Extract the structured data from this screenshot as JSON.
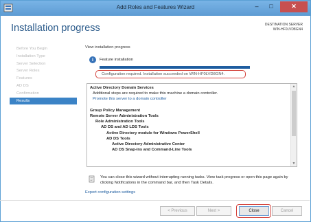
{
  "window": {
    "title": "Add Roles and Features Wizard",
    "minimize_glyph": "–",
    "maximize_glyph": "□",
    "close_glyph": "✕"
  },
  "header": {
    "title": "Installation progress",
    "destination_label": "DESTINATION SERVER",
    "destination_name": "WIN-HF0LVD8GN4"
  },
  "nav": {
    "items": [
      {
        "label": "Before You Begin",
        "active": false
      },
      {
        "label": "Installation Type",
        "active": false
      },
      {
        "label": "Server Selection",
        "active": false
      },
      {
        "label": "Server Roles",
        "active": false
      },
      {
        "label": "Features",
        "active": false
      },
      {
        "label": "AD DS",
        "active": false
      },
      {
        "label": "Confirmation",
        "active": false
      },
      {
        "label": "Results",
        "active": true
      }
    ]
  },
  "main": {
    "view_label": "View installation progress",
    "feature_label": "Feature installation",
    "progress": 1.0,
    "status_text": "Configuration required. Installation succeeded on WIN-HF0LVD8GN4.",
    "results": [
      {
        "text": "Active Directory Domain Services",
        "style": "bold",
        "indent": 0
      },
      {
        "text": "Additional steps are required to make this machine a domain controller.",
        "style": "normal",
        "indent": 1
      },
      {
        "text": "Promote this server to a domain controller",
        "style": "link",
        "indent": 1
      },
      {
        "text": "",
        "style": "normal",
        "indent": 0
      },
      {
        "text": "Group Policy Management",
        "style": "bold",
        "indent": 0
      },
      {
        "text": "Remote Server Administration Tools",
        "style": "bold",
        "indent": 0
      },
      {
        "text": "Role Administration Tools",
        "style": "bold",
        "indent": 2
      },
      {
        "text": "AD DS and AD LDS Tools",
        "style": "bold",
        "indent": 4
      },
      {
        "text": "Active Directory module for Windows PowerShell",
        "style": "bold",
        "indent": 6
      },
      {
        "text": "AD DS Tools",
        "style": "bold",
        "indent": 6
      },
      {
        "text": "Active Directory Administrative Center",
        "style": "bold",
        "indent": 8
      },
      {
        "text": "AD DS Snap-Ins and Command-Line Tools",
        "style": "bold",
        "indent": 8
      }
    ],
    "note_text": "You can close this wizard without interrupting running tasks. View task progress or open this page again by clicking Notifications in the command bar, and then Task Details.",
    "export_link": "Export configuration settings"
  },
  "footer": {
    "previous_label": "< Previous",
    "next_label": "Next >",
    "close_label": "Close",
    "cancel_label": "Cancel"
  },
  "colors": {
    "accent": "#3b83c6",
    "link": "#1e5da0",
    "highlight_ring": "#d4433c"
  }
}
